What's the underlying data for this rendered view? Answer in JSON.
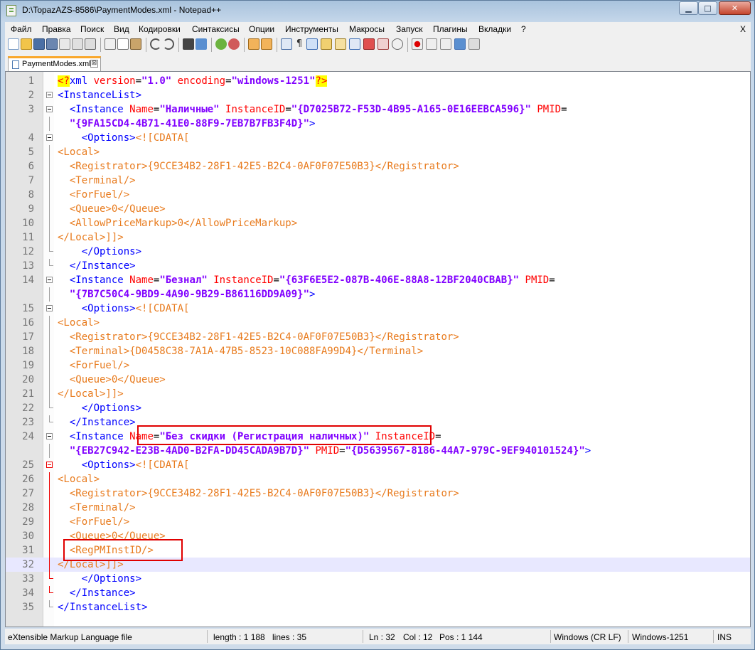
{
  "window": {
    "title": "D:\\TopazAZS-8586\\PaymentModes.xml - Notepad++"
  },
  "window_buttons": {
    "minimize": "▁",
    "maximize": "□",
    "close": "✕"
  },
  "menu": [
    "Файл",
    "Правка",
    "Поиск",
    "Вид",
    "Кодировки",
    "Синтаксисы",
    "Опции",
    "Инструменты",
    "Макросы",
    "Запуск",
    "Плагины",
    "Вкладки",
    "?"
  ],
  "menu_close": "X",
  "toolbar_icons": [
    "new-file",
    "open-file",
    "save",
    "save-all",
    "close",
    "close-all",
    "print",
    "cut",
    "copy",
    "paste",
    "undo",
    "redo",
    "find",
    "replace",
    "zoom-in",
    "zoom-out",
    "sync-v",
    "sync-h",
    "word-wrap",
    "show-all-chars",
    "indent-guide",
    "user-lang",
    "doc-map",
    "function-list",
    "folder-workspace",
    "monitoring",
    "record-macro",
    "stop-record",
    "playback",
    "run-macro-multiple",
    "save-macro"
  ],
  "tab": {
    "label": "PaymentModes.xml",
    "close": "⊠"
  },
  "lines": [
    {
      "n": "1",
      "fold": "none",
      "segments": [
        {
          "c": "pi",
          "t": "<?"
        },
        {
          "c": "t",
          "t": "xml "
        },
        {
          "c": "a",
          "t": "version"
        },
        {
          "c": "k",
          "t": "="
        },
        {
          "c": "v",
          "t": "\"1.0\""
        },
        {
          "c": "k",
          "t": " "
        },
        {
          "c": "a",
          "t": "encoding"
        },
        {
          "c": "k",
          "t": "="
        },
        {
          "c": "v",
          "t": "\"windows-1251\""
        },
        {
          "c": "pi",
          "t": "?>"
        }
      ]
    },
    {
      "n": "2",
      "fold": "box",
      "segments": [
        {
          "c": "t",
          "t": "<InstanceList>"
        }
      ]
    },
    {
      "n": "3",
      "fold": "box",
      "segments": [
        {
          "c": "k",
          "t": "  "
        },
        {
          "c": "t",
          "t": "<Instance "
        },
        {
          "c": "a",
          "t": "Name"
        },
        {
          "c": "k",
          "t": "="
        },
        {
          "c": "v",
          "t": "\"Наличные\""
        },
        {
          "c": "k",
          "t": " "
        },
        {
          "c": "a",
          "t": "InstanceID"
        },
        {
          "c": "k",
          "t": "="
        },
        {
          "c": "v",
          "t": "\"{D7025B72-F53D-4B95-A165-0E16EEBCA596}\""
        },
        {
          "c": "k",
          "t": " "
        },
        {
          "c": "a",
          "t": "PMID"
        },
        {
          "c": "k",
          "t": "="
        }
      ]
    },
    {
      "n": "",
      "fold": "line",
      "segments": [
        {
          "c": "k",
          "t": "  "
        },
        {
          "c": "v",
          "t": "\"{9FA15CD4-4B71-41E0-88F9-7EB7B7FB3F4D}\""
        },
        {
          "c": "t",
          "t": ">"
        }
      ]
    },
    {
      "n": "4",
      "fold": "box",
      "segments": [
        {
          "c": "k",
          "t": "    "
        },
        {
          "c": "t",
          "t": "<Options>"
        },
        {
          "c": "o",
          "t": "<![CDATA["
        }
      ]
    },
    {
      "n": "5",
      "fold": "line",
      "segments": [
        {
          "c": "o",
          "t": "<Local>"
        }
      ]
    },
    {
      "n": "6",
      "fold": "line",
      "segments": [
        {
          "c": "o",
          "t": "  <Registrator>{9CCE34B2-28F1-42E5-B2C4-0AF0F07E50B3}</Registrator>"
        }
      ]
    },
    {
      "n": "7",
      "fold": "line",
      "segments": [
        {
          "c": "o",
          "t": "  <Terminal/>"
        }
      ]
    },
    {
      "n": "8",
      "fold": "line",
      "segments": [
        {
          "c": "o",
          "t": "  <ForFuel/>"
        }
      ]
    },
    {
      "n": "9",
      "fold": "line",
      "segments": [
        {
          "c": "o",
          "t": "  <Queue>0</Queue>"
        }
      ]
    },
    {
      "n": "10",
      "fold": "line",
      "segments": [
        {
          "c": "o",
          "t": "  <AllowPriceMarkup>0</AllowPriceMarkup>"
        }
      ]
    },
    {
      "n": "11",
      "fold": "line",
      "segments": [
        {
          "c": "o",
          "t": "</Local>]]>"
        }
      ]
    },
    {
      "n": "12",
      "fold": "end",
      "segments": [
        {
          "c": "k",
          "t": "    "
        },
        {
          "c": "t",
          "t": "</Options>"
        }
      ]
    },
    {
      "n": "13",
      "fold": "end",
      "segments": [
        {
          "c": "k",
          "t": "  "
        },
        {
          "c": "t",
          "t": "</Instance>"
        }
      ]
    },
    {
      "n": "14",
      "fold": "box",
      "segments": [
        {
          "c": "k",
          "t": "  "
        },
        {
          "c": "t",
          "t": "<Instance "
        },
        {
          "c": "a",
          "t": "Name"
        },
        {
          "c": "k",
          "t": "="
        },
        {
          "c": "v",
          "t": "\"Безнал\""
        },
        {
          "c": "k",
          "t": " "
        },
        {
          "c": "a",
          "t": "InstanceID"
        },
        {
          "c": "k",
          "t": "="
        },
        {
          "c": "v",
          "t": "\"{63F6E5E2-087B-406E-88A8-12BF2040CBAB}\""
        },
        {
          "c": "k",
          "t": " "
        },
        {
          "c": "a",
          "t": "PMID"
        },
        {
          "c": "k",
          "t": "="
        }
      ]
    },
    {
      "n": "",
      "fold": "line",
      "segments": [
        {
          "c": "k",
          "t": "  "
        },
        {
          "c": "v",
          "t": "\"{7B7C50C4-9BD9-4A90-9B29-B86116DD9A09}\""
        },
        {
          "c": "t",
          "t": ">"
        }
      ]
    },
    {
      "n": "15",
      "fold": "box",
      "segments": [
        {
          "c": "k",
          "t": "    "
        },
        {
          "c": "t",
          "t": "<Options>"
        },
        {
          "c": "o",
          "t": "<![CDATA["
        }
      ]
    },
    {
      "n": "16",
      "fold": "line",
      "segments": [
        {
          "c": "o",
          "t": "<Local>"
        }
      ]
    },
    {
      "n": "17",
      "fold": "line",
      "segments": [
        {
          "c": "o",
          "t": "  <Registrator>{9CCE34B2-28F1-42E5-B2C4-0AF0F07E50B3}</Registrator>"
        }
      ]
    },
    {
      "n": "18",
      "fold": "line",
      "segments": [
        {
          "c": "o",
          "t": "  <Terminal>{D0458C38-7A1A-47B5-8523-10C088FA99D4}</Terminal>"
        }
      ]
    },
    {
      "n": "19",
      "fold": "line",
      "segments": [
        {
          "c": "o",
          "t": "  <ForFuel/>"
        }
      ]
    },
    {
      "n": "20",
      "fold": "line",
      "segments": [
        {
          "c": "o",
          "t": "  <Queue>0</Queue>"
        }
      ]
    },
    {
      "n": "21",
      "fold": "line",
      "segments": [
        {
          "c": "o",
          "t": "</Local>]]>"
        }
      ]
    },
    {
      "n": "22",
      "fold": "end",
      "segments": [
        {
          "c": "k",
          "t": "    "
        },
        {
          "c": "t",
          "t": "</Options>"
        }
      ]
    },
    {
      "n": "23",
      "fold": "end",
      "segments": [
        {
          "c": "k",
          "t": "  "
        },
        {
          "c": "t",
          "t": "</Instance>"
        }
      ]
    },
    {
      "n": "24",
      "fold": "box",
      "segments": [
        {
          "c": "k",
          "t": "  "
        },
        {
          "c": "t",
          "t": "<Instance "
        },
        {
          "c": "a",
          "t": "Name"
        },
        {
          "c": "k",
          "t": "="
        },
        {
          "c": "v",
          "t": "\"Без скидки (Регистрация наличных)\""
        },
        {
          "c": "k",
          "t": " "
        },
        {
          "c": "a",
          "t": "InstanceID"
        },
        {
          "c": "k",
          "t": "="
        }
      ]
    },
    {
      "n": "",
      "fold": "line",
      "segments": [
        {
          "c": "k",
          "t": "  "
        },
        {
          "c": "v",
          "t": "\"{EB27C942-E23B-4AD0-B2FA-DD45CADA9B7D}\""
        },
        {
          "c": "k",
          "t": " "
        },
        {
          "c": "a",
          "t": "PMID"
        },
        {
          "c": "k",
          "t": "="
        },
        {
          "c": "v",
          "t": "\"{D5639567-8186-44A7-979C-9EF940101524}\""
        },
        {
          "c": "t",
          "t": ">"
        }
      ]
    },
    {
      "n": "25",
      "fold": "boxred",
      "segments": [
        {
          "c": "k",
          "t": "    "
        },
        {
          "c": "t",
          "t": "<Options>"
        },
        {
          "c": "o",
          "t": "<![CDATA["
        }
      ]
    },
    {
      "n": "26",
      "fold": "linered",
      "segments": [
        {
          "c": "o",
          "t": "<Local>"
        }
      ]
    },
    {
      "n": "27",
      "fold": "linered",
      "segments": [
        {
          "c": "o",
          "t": "  <Registrator>{9CCE34B2-28F1-42E5-B2C4-0AF0F07E50B3}</Registrator>"
        }
      ]
    },
    {
      "n": "28",
      "fold": "linered",
      "segments": [
        {
          "c": "o",
          "t": "  <Terminal/>"
        }
      ]
    },
    {
      "n": "29",
      "fold": "linered",
      "segments": [
        {
          "c": "o",
          "t": "  <ForFuel/>"
        }
      ]
    },
    {
      "n": "30",
      "fold": "linered",
      "segments": [
        {
          "c": "o",
          "t": "  <Queue>0</Queue>"
        }
      ]
    },
    {
      "n": "31",
      "fold": "linered",
      "segments": [
        {
          "c": "o",
          "t": "  <RegPMInstID/>"
        }
      ]
    },
    {
      "n": "32",
      "fold": "linered",
      "current": true,
      "segments": [
        {
          "c": "o",
          "t": "</Local>]]>"
        }
      ]
    },
    {
      "n": "33",
      "fold": "endred",
      "segments": [
        {
          "c": "k",
          "t": "    "
        },
        {
          "c": "t",
          "t": "</Options>"
        }
      ]
    },
    {
      "n": "34",
      "fold": "endred",
      "segments": [
        {
          "c": "k",
          "t": "  "
        },
        {
          "c": "t",
          "t": "</Instance>"
        }
      ]
    },
    {
      "n": "35",
      "fold": "lastend",
      "segments": [
        {
          "c": "t",
          "t": "</InstanceList>"
        }
      ]
    }
  ],
  "status": {
    "filetype": "eXtensible Markup Language file",
    "length": "length : 1 188",
    "lines": "lines : 35",
    "ln": "Ln : 32",
    "col": "Col : 12",
    "pos": "Pos : 1 144",
    "eol": "Windows (CR LF)",
    "encoding": "Windows-1251",
    "mode": "INS"
  },
  "colors": {
    "tag": "#0000ff",
    "attr": "#ff0000",
    "value": "#8000ff",
    "cdata": "#e87b1e",
    "highlight_box": "#e00000",
    "current_line": "#e8e8ff"
  }
}
